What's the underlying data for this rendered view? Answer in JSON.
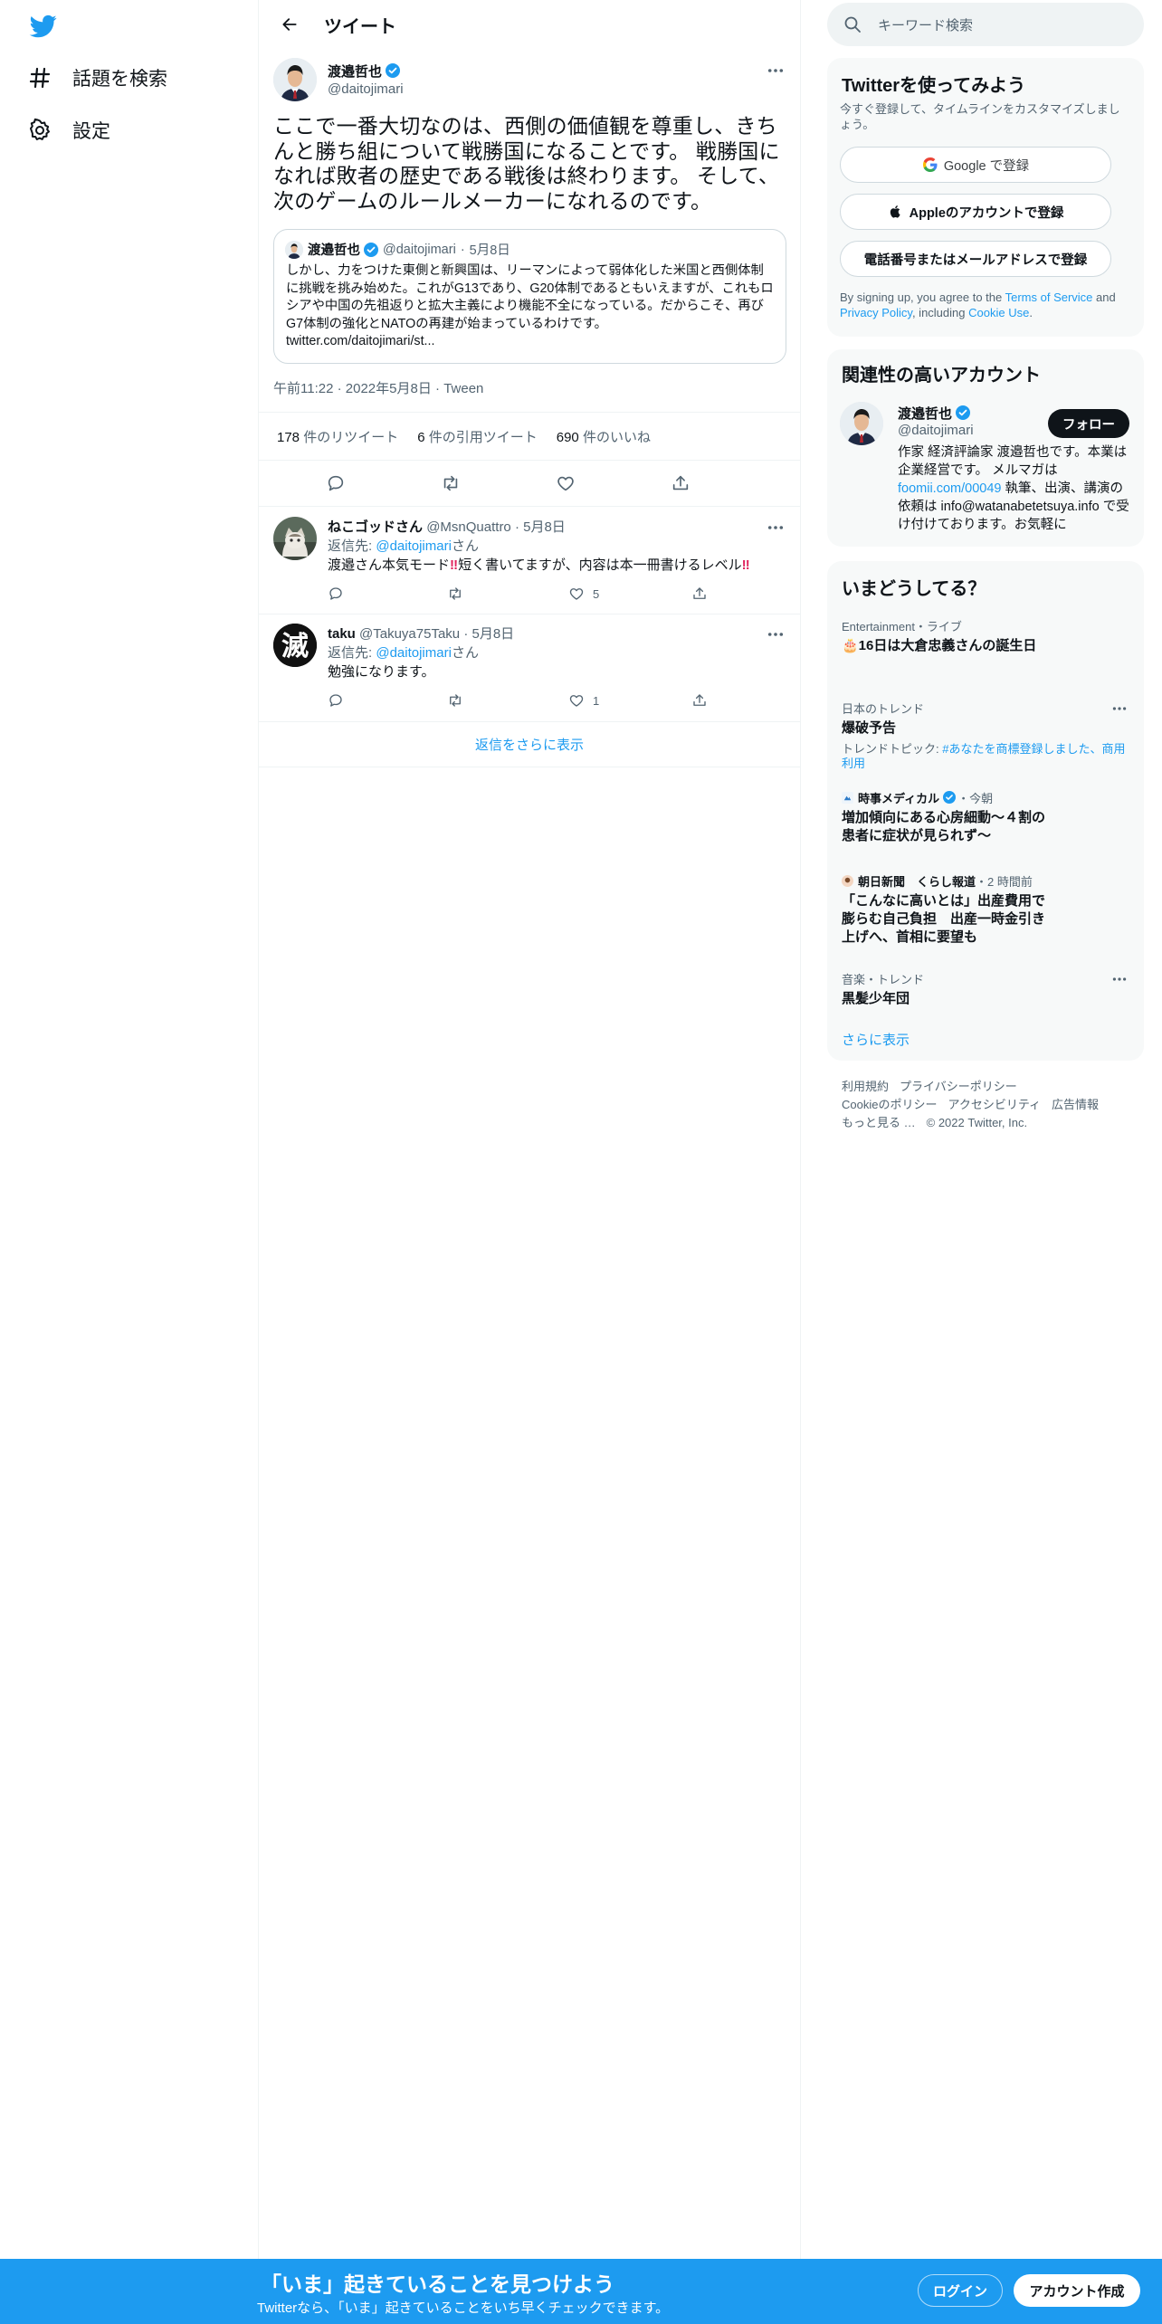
{
  "app": "Twitter",
  "colors": {
    "accent": "#1d9bf0",
    "text": "#0f1419",
    "secondary": "#536471",
    "bottom_bar": "#1d9bf0"
  },
  "left_nav": {
    "items": [
      {
        "icon": "hashtag-icon",
        "label": "話題を検索"
      },
      {
        "icon": "gear-icon",
        "label": "設定"
      }
    ]
  },
  "header": {
    "title": "ツイート"
  },
  "tweet": {
    "author_name": "渡邉哲也",
    "author_handle": "@daitojimari",
    "text": "ここで一番大切なのは、西側の価値観を尊重し、きちんと勝ち組について戦勝国になることです。 戦勝国になれば敗者の歴史である戦後は終わります。 そして、次のゲームのルールメーカーになれるのです。",
    "quote": {
      "author_name": "渡邉哲也",
      "author_handle": "@daitojimari",
      "date": "5月8日",
      "text": "しかし、力をつけた東側と新興国は、リーマンによって弱体化した米国と西側体制に挑戦を挑み始めた。これがG13であり、G20体制であるともいえますが、これもロシアや中国の先祖返りと拡大主義により機能不全になっている。だからこそ、再びG7体制の強化とNATOの再建が始まっているわけです。",
      "link": "twitter.com/daitojimari/st..."
    },
    "time": "午前11:22",
    "date": "2022年5月8日",
    "source": "Tween",
    "retweets": "178",
    "retweets_label": "件のリツイート",
    "quotes": "6",
    "quotes_label": "件の引用ツイート",
    "likes": "690",
    "likes_label": "件のいいね"
  },
  "replies": [
    {
      "name": "ねこゴッドさん",
      "handle": "@MsnQuattro",
      "date": "5月8日",
      "reply_to_prefix": "返信先: ",
      "reply_to": "@daitojimari",
      "reply_to_suffix": "さん",
      "text_main": "渡邉さん本気モード",
      "text_mid": "短く書いてますが、内容は本一冊書けるレベル",
      "emoji": "‼",
      "likes": "5"
    },
    {
      "name": "taku",
      "handle": "@Takuya75Taku",
      "date": "5月8日",
      "reply_to_prefix": "返信先: ",
      "reply_to": "@daitojimari",
      "reply_to_suffix": "さん",
      "text": "勉強になります。",
      "likes": "1",
      "avatar_glyph": "滅"
    }
  ],
  "more_replies": "返信をさらに表示",
  "search": {
    "placeholder": "キーワード検索"
  },
  "signup": {
    "title": "Twitterを使ってみよう",
    "subtitle": "今すぐ登録して、タイムラインをカスタマイズしましょう。",
    "google": "Google で登録",
    "apple": "Appleのアカウントで登録",
    "phone": "電話番号またはメールアドレスで登録",
    "terms_prefix": "By signing up, you agree to the ",
    "terms_tos": "Terms of Service",
    "terms_and": " and ",
    "terms_privacy": "Privacy Policy",
    "terms_including": ", including ",
    "terms_cookie": "Cookie Use",
    "terms_end": "."
  },
  "related": {
    "title": "関連性の高いアカウント",
    "name": "渡邉哲也",
    "handle": "@daitojimari",
    "follow": "フォロー",
    "bio_1": "作家 経済評論家 渡邉哲也です。本業は企業経営です。 メルマガは",
    "bio_link": "foomii.com/00049",
    "bio_2": " 執筆、出演、講演の依頼は info@watanabetetsuya.info で受け付けております。お気軽に"
  },
  "trends": {
    "title": "いまどうしてる？",
    "items": [
      {
        "meta": "Entertainment・ライブ",
        "name": "🎂16日は大倉忠義さんの誕生日"
      },
      {
        "meta": "日本のトレンド",
        "name": "爆破予告",
        "sub_prefix": "トレンドトピック: ",
        "sub_link": "#あなたを商標登録しました、商用利用"
      },
      {
        "meta_name": "時事メディカル",
        "meta_time": "・今朝",
        "name": "増加傾向にある心房細動～４割の患者に症状が見られず～"
      },
      {
        "meta_name": "朝日新聞　くらし報道",
        "meta_time": "・2 時間前",
        "name": "「こんなに高いとは」出産費用で膨らむ自己負担　出産一時金引き上げへ、首相に要望も"
      },
      {
        "meta": "音楽・トレンド",
        "name": "黒髪少年団"
      }
    ],
    "show_more": "さらに表示"
  },
  "footer": {
    "links": [
      "利用規約",
      "プライバシーポリシー",
      "Cookieのポリシー",
      "アクセシビリティ",
      "広告情報",
      "もっと見る …"
    ],
    "copyright": "© 2022 Twitter, Inc."
  },
  "bottom_bar": {
    "title": "「いま」起きていることを見つけよう",
    "subtitle": "Twitterなら、「いま」起きていることをいち早くチェックできます。",
    "login": "ログイン",
    "signup": "アカウント作成"
  }
}
